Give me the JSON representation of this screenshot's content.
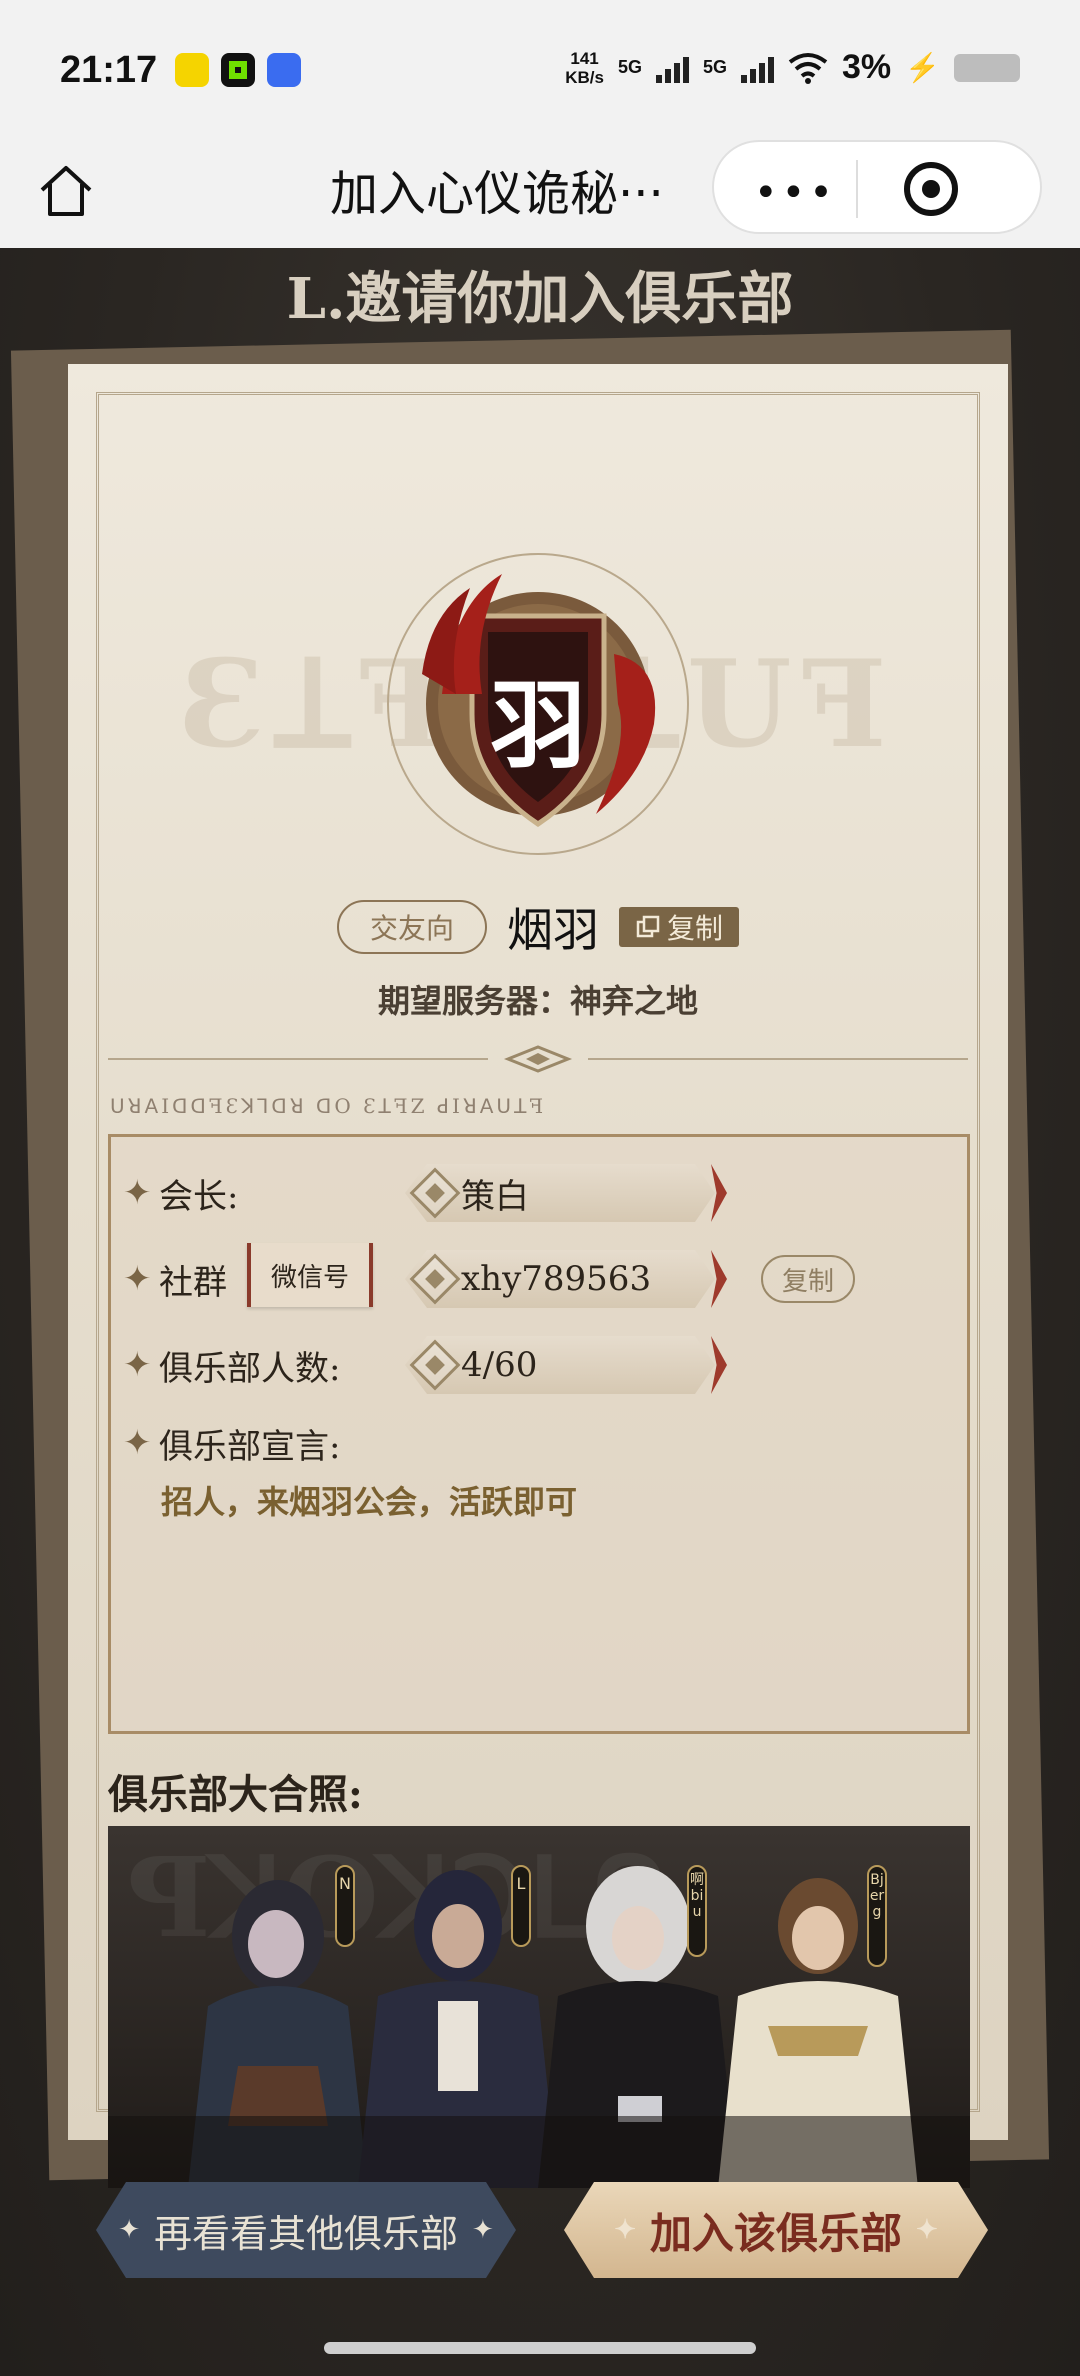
{
  "status_bar": {
    "time": "21:17",
    "net_speed_value": "141",
    "net_speed_unit": "KB/s",
    "sig1": "5G",
    "sig2": "5G",
    "battery": "3%"
  },
  "nav": {
    "title": "加入心仪诡秘···"
  },
  "page": {
    "heading": "L.邀请你加入俱乐部",
    "emblem_char": "羽",
    "tag": "交友向",
    "club_name": "烟羽",
    "copy_label": "复制",
    "server_label": "期望服务器：",
    "server_value": "神弃之地",
    "info": {
      "leader_label": "会长:",
      "leader_value": "策白",
      "community_label": "社群",
      "wechat_tag": "微信号",
      "community_value": "xhy789563",
      "community_copy": "复制",
      "members_label": "俱乐部人数:",
      "members_value": "4/60",
      "declaration_label": "俱乐部宣言:",
      "declaration_value": "招人，来烟羽公会，活跃即可"
    },
    "photo_title": "俱乐部大合照:",
    "photo_tags": [
      "N",
      "L",
      "啊biu",
      "Bjerg"
    ]
  },
  "buttons": {
    "other_clubs": "再看看其他俱乐部",
    "join": "加入该俱乐部"
  }
}
